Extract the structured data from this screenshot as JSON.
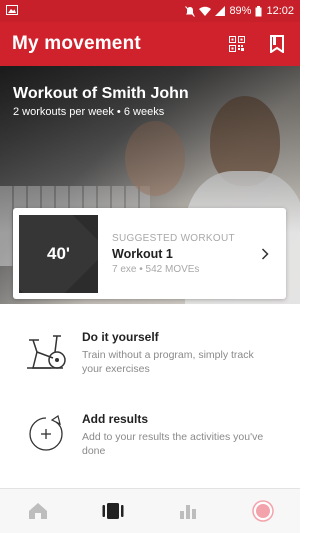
{
  "status_bar": {
    "battery": "89%",
    "time": "12:02",
    "icons": [
      "image-notification-icon",
      "mute-icon",
      "wifi-icon",
      "signal-icon",
      "battery-icon"
    ]
  },
  "app_bar": {
    "title": "My movement",
    "actions": [
      "qr-code-icon",
      "bookmark-icon"
    ]
  },
  "hero": {
    "title": "Workout of Smith John",
    "subtitle": "2 workouts per week • 6 weeks"
  },
  "suggested": {
    "thumb_text": "40'",
    "eyebrow": "SUGGESTED WORKOUT",
    "title": "Workout 1",
    "meta": "7 exe • 542 MOVEs"
  },
  "options": [
    {
      "icon": "exercise-bike-icon",
      "title": "Do it yourself",
      "description": "Train without a program, simply track your exercises"
    },
    {
      "icon": "add-results-icon",
      "title": "Add results",
      "description": "Add to your results the activities you've done"
    }
  ],
  "bottom_nav": {
    "items": [
      "home-icon",
      "workouts-icon",
      "stats-icon",
      "profile-icon"
    ],
    "active": "workouts-icon"
  },
  "colors": {
    "brand_red": "#d0222c",
    "status_red": "#c8202a"
  }
}
